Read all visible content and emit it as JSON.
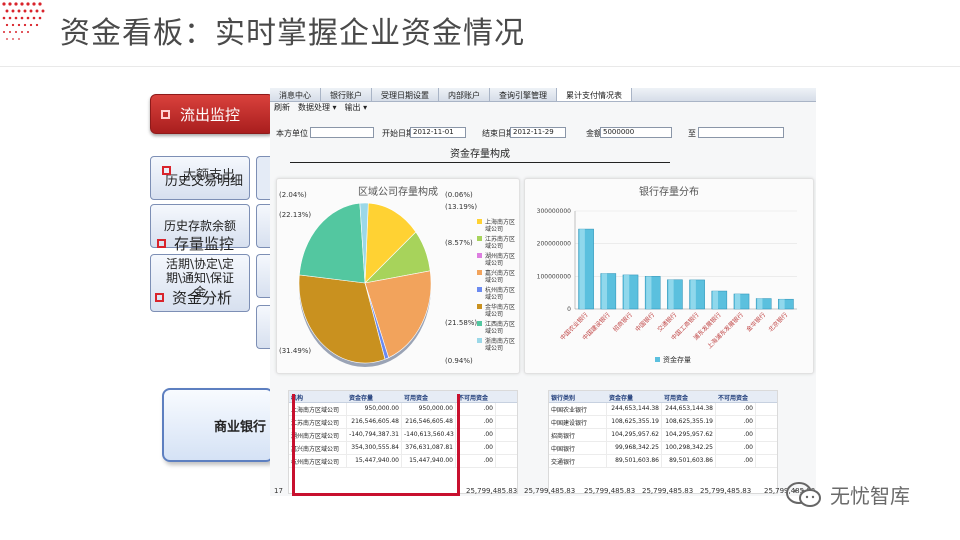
{
  "slide": {
    "title": "资金看板：实时掌握企业资金情况",
    "menu_active": "流出监控",
    "overlap_labels": [
      "大额支出",
      "历史交易明细",
      "存量监控",
      "资金分析"
    ],
    "cards": [
      "历史存款余额",
      "活期\\协定\\定期\\通知\\保证金",
      "商业银行"
    ],
    "watermark": "无忧智库"
  },
  "app": {
    "tabs": [
      "消息中心",
      "银行账户",
      "受理日期设置",
      "内部账户",
      "查询引擎管理",
      "累计支付情况表"
    ],
    "active_tab": "累计支付情况表",
    "toolbar": [
      "刷新",
      "数据处理 ▾",
      "输出 ▾"
    ],
    "filters": {
      "unit_label": "本方单位",
      "start_label": "开始日期",
      "start_value": "2012-11-01",
      "end_label": "结束日期",
      "end_value": "2012-11-29",
      "amount_label": "金额",
      "amount_value": "5000000",
      "to_label": "至"
    },
    "section_title": "资金存量构成"
  },
  "chart_data": [
    {
      "type": "pie",
      "title": "区域公司存量构成",
      "labels": [
        "上海南方区域公司",
        "江苏南方区域公司",
        "湖州南方区域公司",
        "嘉兴南方区域公司",
        "杭州南方区域公司",
        "金华南方区域公司",
        "江西南方区域公司",
        "浙南南方区域公司"
      ],
      "values": [
        13.19,
        8.57,
        0.0,
        21.58,
        0.94,
        31.49,
        22.13,
        2.04
      ],
      "data_labels": [
        "(0.06%)",
        "(13.19%)",
        "(8.57%)",
        "(21.58%)",
        "(0.94%)",
        "(31.49%)",
        "(22.13%)",
        "(2.04%)"
      ],
      "colors": [
        "#ffd233",
        "#a7d35b",
        "#dd7ee0",
        "#f2a35c",
        "#6b8af0",
        "#c9911f",
        "#53c7a0",
        "#9bd8e8"
      ],
      "legend": "right"
    },
    {
      "type": "bar",
      "title": "银行存量分布",
      "categories": [
        "中国农业银行",
        "中国建设银行",
        "招商银行",
        "中国银行",
        "交通银行",
        "中国工商银行",
        "浦东发展银行",
        "上海浦东发展银行",
        "金华银行",
        "北京银行"
      ],
      "values": [
        244653144,
        108625355,
        104295957,
        99968342,
        89501603,
        89000000,
        55000000,
        46000000,
        32000000,
        30000000
      ],
      "ylim": [
        0,
        300000000
      ],
      "yticks": [
        "0",
        "100000000",
        "200000000",
        "300000000"
      ],
      "series_name": "资金存量",
      "legend": "bottom"
    }
  ],
  "grid_left": {
    "headers": [
      "机构",
      "资金存量",
      "可用资金",
      "不可用资金"
    ],
    "rows": [
      [
        "上海南方区域公司",
        "950,000.00",
        "950,000.00",
        ".00"
      ],
      [
        "江苏南方区域公司",
        "216,546,605.48",
        "216,546,605.48",
        ".00"
      ],
      [
        "湖州南方区域公司",
        "-140,794,387.31",
        "-140,613,560.43",
        ".00"
      ],
      [
        "嘉兴南方区域公司",
        "354,300,555.84",
        "376,631,087.81",
        ".00"
      ],
      [
        "杭州南方区域公司",
        "15,447,940.00",
        "15,447,940.00",
        ".00"
      ]
    ]
  },
  "grid_right": {
    "headers": [
      "银行类别",
      "资金存量",
      "可用资金",
      "不可用资金"
    ],
    "rows": [
      [
        "中国农业银行",
        "244,653,144.38",
        "244,653,144.38",
        ".00"
      ],
      [
        "中国建设银行",
        "108,625,355.19",
        "108,625,355.19",
        ".00"
      ],
      [
        "招商银行",
        "104,295,957.62",
        "104,295,957.62",
        ".00"
      ],
      [
        "中国银行",
        "99,968,342.25",
        "100,298,342.25",
        ".00"
      ],
      [
        "交通银行",
        "89,501,603.86",
        "89,501,603.86",
        ".00"
      ]
    ]
  },
  "footer": [
    "17",
    "25,799,485.83",
    "25,799,485.83",
    "25,799,485.83",
    "25,799,485.83",
    "25,799,485.83",
    "25,799,485.83"
  ]
}
